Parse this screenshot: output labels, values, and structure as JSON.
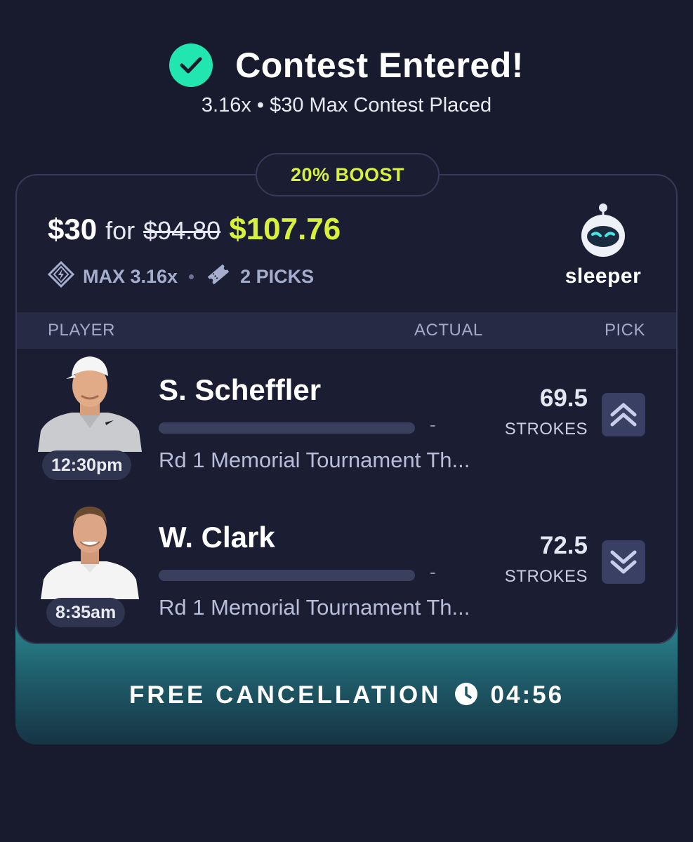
{
  "header": {
    "title": "Contest Entered!",
    "subtitle": "3.16x • $30 Max Contest Placed"
  },
  "card": {
    "boost_label": "20% BOOST",
    "stake": "$30",
    "for_word": "for",
    "original_payout": "$94.80",
    "boosted_payout": "$107.76",
    "multiplier_label": "MAX 3.16x",
    "picks_label": "2 PICKS",
    "brand_name": "sleeper"
  },
  "table": {
    "columns": {
      "player": "PLAYER",
      "actual": "ACTUAL",
      "pick": "PICK"
    },
    "rows": [
      {
        "name": "S. Scheffler",
        "tee_time": "12:30pm",
        "actual": "-",
        "event": "Rd 1 Memorial Tournament Th...",
        "line": "69.5",
        "stat": "STROKES",
        "pick": "more",
        "pick_icon": "chevrons-up-icon",
        "progress": 0
      },
      {
        "name": "W. Clark",
        "tee_time": "8:35am",
        "actual": "-",
        "event": "Rd 1 Memorial Tournament Th...",
        "line": "72.5",
        "stat": "STROKES",
        "pick": "less",
        "pick_icon": "chevrons-down-icon",
        "progress": 0
      }
    ]
  },
  "footer": {
    "cancel_label": "FREE CANCELLATION",
    "timer": "04:56"
  },
  "colors": {
    "background": "#181b2e",
    "accent_green": "#21e6b0",
    "boost_yellow": "#d8f23a",
    "teal": "#2a8d96"
  }
}
